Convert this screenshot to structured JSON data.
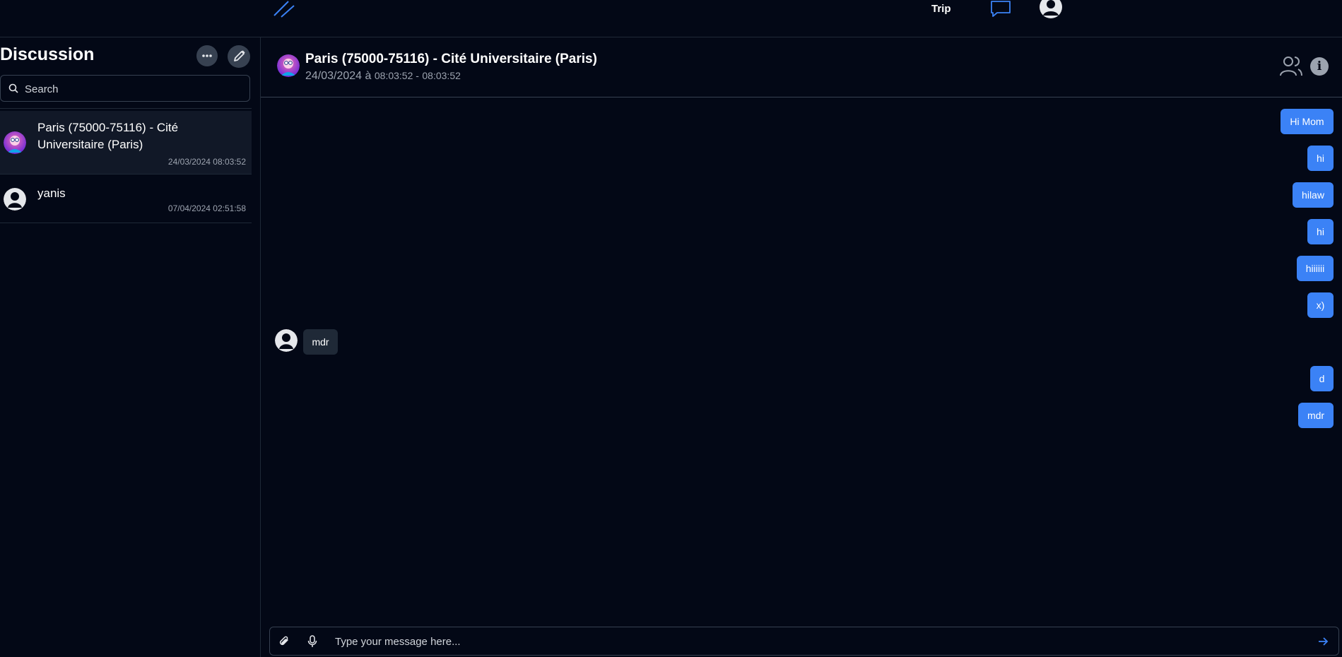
{
  "topnav": {
    "logo_icon": "slash-logo-icon",
    "trip_label": "Trip",
    "chat_icon": "chat-bubble-icon",
    "profile_icon": "user-avatar-icon",
    "accent": "#3b82f6"
  },
  "sidebar": {
    "title": "Discussion",
    "more_icon": "ellipsis-icon",
    "compose_icon": "compose-icon",
    "search": {
      "placeholder": "Search",
      "icon": "search-icon"
    },
    "conversations": [
      {
        "name": "Paris (75000-75116) - Cité Universitaire (Paris)",
        "date": "24/03/2024 08:03:52",
        "avatar": "group-avatar",
        "active": true
      },
      {
        "name": "yanis",
        "date": "07/04/2024 02:51:58",
        "avatar": "user-avatar",
        "active": false
      }
    ]
  },
  "chat": {
    "title": "Paris (75000-75116) - Cité Universitaire (Paris)",
    "date": "24/03/2024 à",
    "time_start": "08:03:52 -",
    "time_end": "08:03:52",
    "members_icon": "users-icon",
    "info_label": "i",
    "messages": [
      {
        "text": "Hi Mom",
        "sender": "me"
      },
      {
        "text": "hi",
        "sender": "me"
      },
      {
        "text": "hilaw",
        "sender": "me"
      },
      {
        "text": "hi",
        "sender": "me"
      },
      {
        "text": "hiiiiii",
        "sender": "me"
      },
      {
        "text": "x)",
        "sender": "me"
      },
      {
        "text": "mdr",
        "sender": "other"
      },
      {
        "text": "d",
        "sender": "me"
      },
      {
        "text": "mdr",
        "sender": "me"
      }
    ]
  },
  "composer": {
    "placeholder": "Type your message here...",
    "attach_icon": "paperclip-icon",
    "mic_icon": "microphone-icon",
    "send_icon": "arrow-right-icon"
  }
}
